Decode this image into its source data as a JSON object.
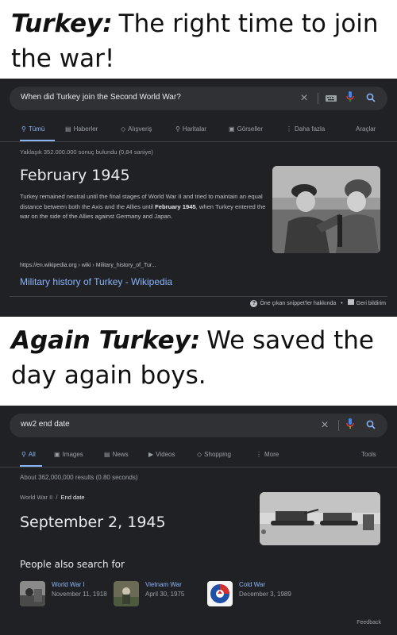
{
  "caption1": {
    "who": "Turkey:",
    "text": "The right time to join the war!"
  },
  "caption2": {
    "who": "Again Turkey:",
    "text": "We saved the day again boys."
  },
  "panel1": {
    "query": "When did Turkey join the Second World War?",
    "tabs": [
      {
        "label": "Tümü",
        "icon": "search-icon",
        "glyph": "⚲"
      },
      {
        "label": "Haberler",
        "icon": "news-icon",
        "glyph": "▤"
      },
      {
        "label": "Alışveriş",
        "icon": "tag-icon",
        "glyph": "◇"
      },
      {
        "label": "Haritalar",
        "icon": "map-pin-icon",
        "glyph": "⚲"
      },
      {
        "label": "Görseller",
        "icon": "image-icon",
        "glyph": "▣"
      },
      {
        "label": "Daha fazla",
        "icon": "more-vert-icon",
        "glyph": "⋮"
      }
    ],
    "tools": "Araçlar",
    "result_stats": "Yaklaşık 352.000.000 sonuç bulundu (0,84 saniye)",
    "answer": "February 1945",
    "description_before": "Turkey remained neutral until the final stages of World War II and tried to maintain an equal distance between both the Axis and the Allies until ",
    "description_bold": "February 1945",
    "description_after": ", when Turkey entered the war on the side of the Allies against Germany and Japan.",
    "source_url": "https://en.wikipedia.org › wiki › Military_history_of_Tur...",
    "source_title": "Military history of Turkey - Wikipedia",
    "footer_about": "Öne çıkan snippet'ler hakkında",
    "footer_sep": "•",
    "footer_feedback": "Geri bildirim"
  },
  "panel2": {
    "query": "ww2 end date",
    "tabs": [
      {
        "label": "All",
        "icon": "search-icon",
        "glyph": "⚲"
      },
      {
        "label": "Images",
        "icon": "image-icon",
        "glyph": "▣"
      },
      {
        "label": "News",
        "icon": "news-icon",
        "glyph": "▤"
      },
      {
        "label": "Videos",
        "icon": "video-icon",
        "glyph": "▶"
      },
      {
        "label": "Shopping",
        "icon": "tag-icon",
        "glyph": "◇"
      },
      {
        "label": "More",
        "icon": "more-vert-icon",
        "glyph": "⋮"
      }
    ],
    "tools": "Tools",
    "result_stats": "About 362,000,000 results (0.80 seconds)",
    "breadcrumb_parent": "World War II",
    "breadcrumb_sep": "/",
    "breadcrumb_current": "End date",
    "answer": "September 2, 1945",
    "people_also_search": "People also search for",
    "related": [
      {
        "title": "World War I",
        "date": "November 11, 1918"
      },
      {
        "title": "Vietnam War",
        "date": "April 30, 1975"
      },
      {
        "title": "Cold War",
        "date": "December 3, 1989"
      }
    ],
    "feedback": "Feedback"
  },
  "colors": {
    "background": "#202124",
    "search_bar": "#303134",
    "link": "#8ab4f8",
    "text_primary": "#e8eaed",
    "text_muted": "#9aa0a6",
    "mic_red": "#ea4335",
    "mic_blue": "#4285f4",
    "mic_yellow": "#fbbc04",
    "mic_green": "#34a853"
  }
}
